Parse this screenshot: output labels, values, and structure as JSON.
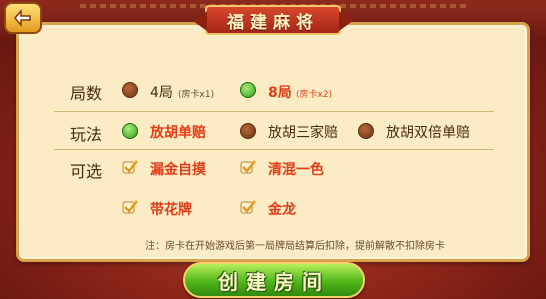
{
  "title": "福建麻将",
  "rows": {
    "rounds": {
      "label": "局数",
      "options": [
        {
          "label": "4局",
          "sub": "(房卡x1)",
          "selected": false
        },
        {
          "label": "8局",
          "sub": "(房卡x2)",
          "selected": true
        }
      ]
    },
    "mode": {
      "label": "玩法",
      "options": [
        {
          "label": "放胡单赔",
          "selected": true
        },
        {
          "label": "放胡三家赔",
          "selected": false
        },
        {
          "label": "放胡双倍单赔",
          "selected": false
        }
      ]
    },
    "optional": {
      "label": "可选",
      "options": [
        {
          "label": "漏金自摸",
          "checked": true
        },
        {
          "label": "清混一色",
          "checked": true
        },
        {
          "label": "带花牌",
          "checked": true
        },
        {
          "label": "金龙",
          "checked": true
        }
      ]
    }
  },
  "note": "注：房卡在开始游戏后第一局牌局结算后扣除，提前解散不扣除房卡",
  "create_button": "创建房间",
  "colors": {
    "selected_text": "#e43c16",
    "panel": "#fbecc6",
    "button": "#52b61a"
  }
}
